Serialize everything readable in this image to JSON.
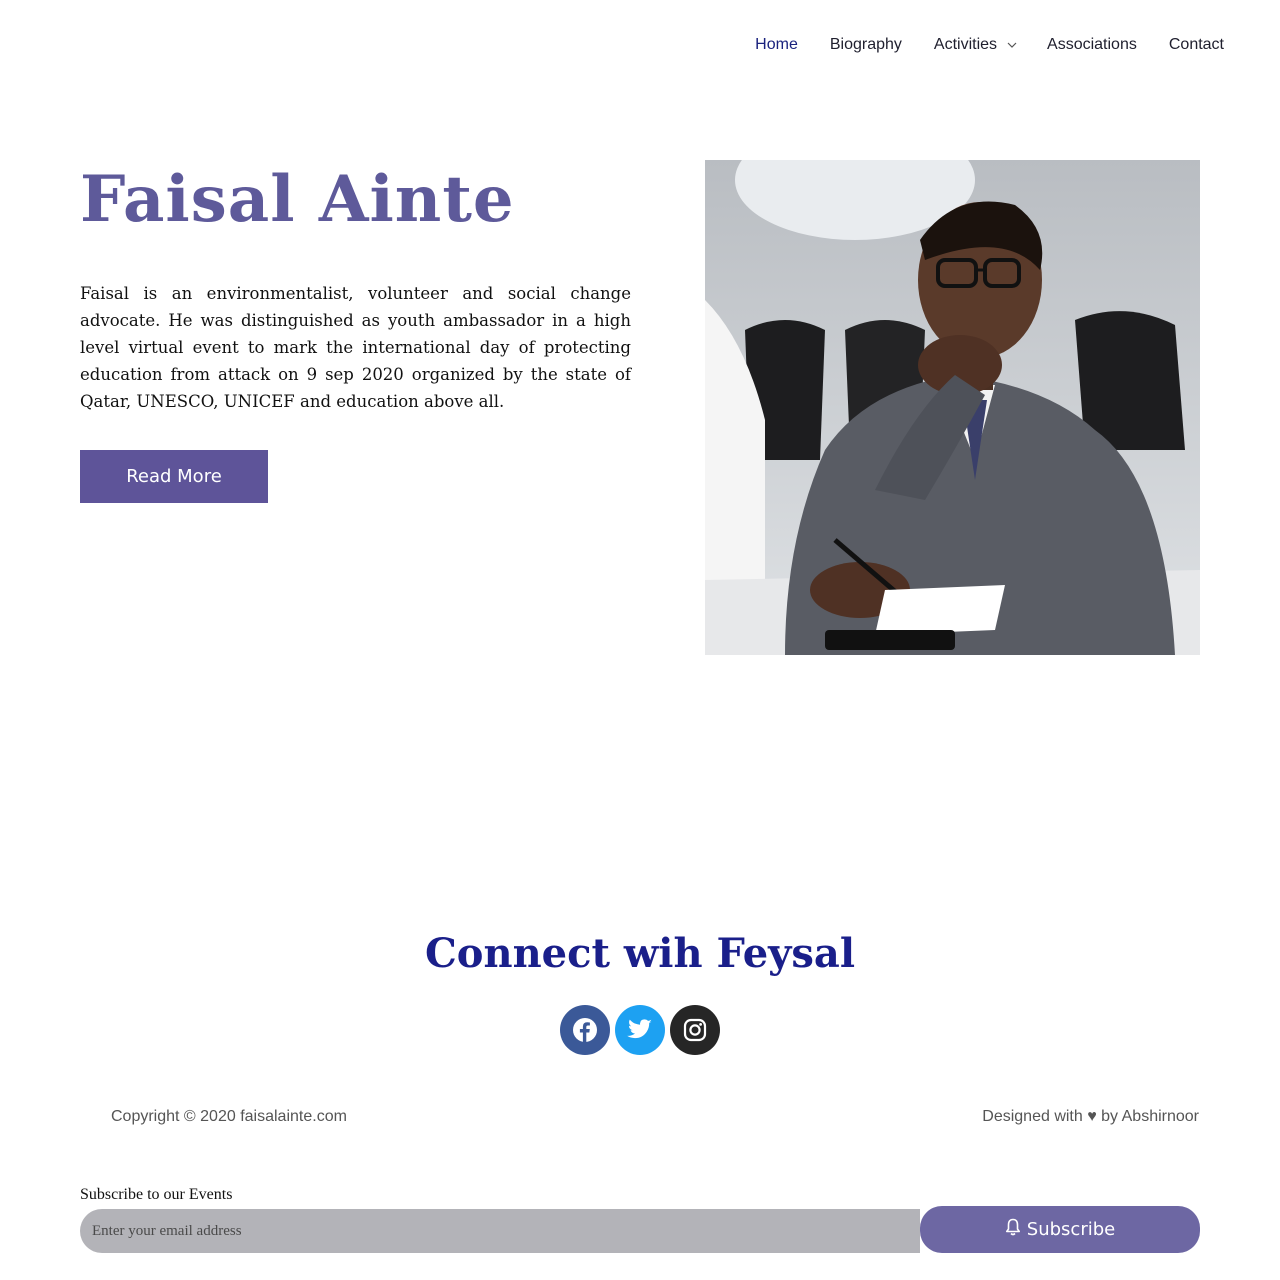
{
  "nav": {
    "items": [
      {
        "label": "Home",
        "active": true
      },
      {
        "label": "Biography"
      },
      {
        "label": "Activities",
        "has_dropdown": true
      },
      {
        "label": "Associations"
      },
      {
        "label": "Contact"
      }
    ]
  },
  "hero": {
    "title": "Faisal Ainte",
    "description": "Faisal is an environmentalist, volunteer and social change advocate. He was distinguished as youth ambassador in a high level virtual event to mark the international day of protecting education from attack on 9 sep 2020 organized by the state of Qatar, UNESCO, UNICEF and education above all.",
    "button_label": "Read More",
    "photo_icon": "portrait-photo"
  },
  "connect": {
    "title": "Connect wih Feysal",
    "socials": [
      {
        "icon": "facebook-icon",
        "color": "#3b5998"
      },
      {
        "icon": "twitter-icon",
        "color": "#1da1f2"
      },
      {
        "icon": "instagram-icon",
        "color": "#262626"
      }
    ]
  },
  "footer": {
    "copyright": "Copyright © 2020 faisalainte.com",
    "designed": "Designed with ♥ by Abshirnoor"
  },
  "subscribe": {
    "label": "Subscribe to our Events",
    "placeholder": "Enter your email address",
    "button_label": "Subscribe"
  },
  "colors": {
    "accent": "#5e5499",
    "title": "#5e5a9a",
    "connect_title": "#1a1f8a",
    "active_nav": "#1a237e"
  }
}
